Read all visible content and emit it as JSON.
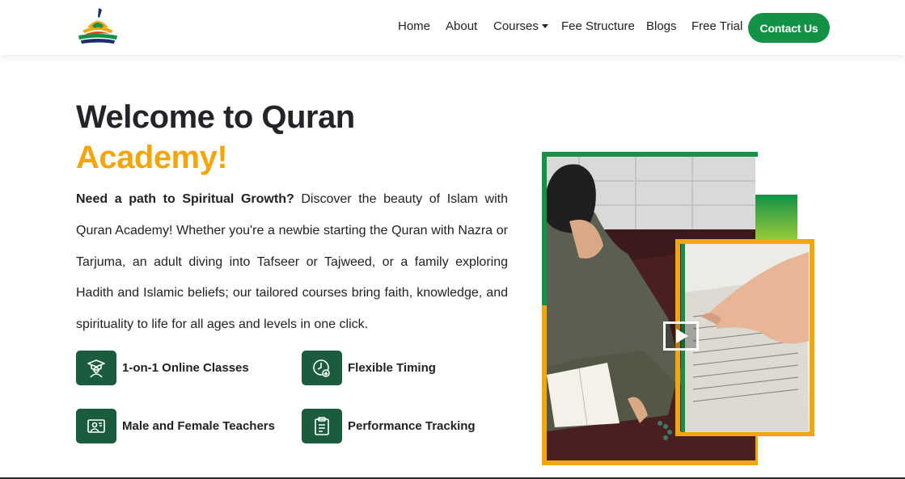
{
  "header": {
    "logo_alt": "Quran Academy logo",
    "nav": [
      "Home",
      "About",
      "Courses",
      "Fee Structure",
      "Blogs",
      "Free Trial"
    ],
    "contact_label": "Contact Us"
  },
  "hero": {
    "title_line1": "Welcome to Quran",
    "title_line2": "Academy!",
    "intro_bold": "Need a path to Spiritual Growth?",
    "intro_rest": " Discover the beauty of Islam with Quran Academy! Whether you're a newbie starting the Quran with Nazra or Tarjuma, an adult diving into Tafseer or Tajweed, or a family exploring Hadith and Islamic beliefs; our tailored courses bring faith, knowledge, and spirituality to life for all ages and levels in one click."
  },
  "features": [
    {
      "label": "1-on-1 Online Classes",
      "icon": "teacher-icon"
    },
    {
      "label": "Flexible Timing",
      "icon": "clock-icon"
    },
    {
      "label": "Male and Female Teachers",
      "icon": "presentation-icon"
    },
    {
      "label": "Performance Tracking",
      "icon": "clipboard-icon"
    }
  ],
  "colors": {
    "brand_green": "#129147",
    "accent_orange": "#f2a60c",
    "icon_bg": "#1a5c3d"
  }
}
